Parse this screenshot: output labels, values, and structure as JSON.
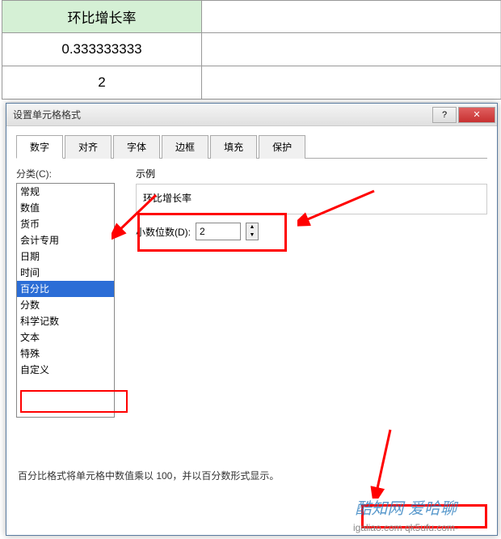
{
  "sheet": {
    "header": "环比增长率",
    "rows": [
      "0.333333333",
      "2"
    ]
  },
  "dialog": {
    "title": "设置单元格格式",
    "tabs": [
      "数字",
      "对齐",
      "字体",
      "边框",
      "填充",
      "保护"
    ],
    "category_label": "分类(C):",
    "categories": [
      "常规",
      "数值",
      "货币",
      "会计专用",
      "日期",
      "时间",
      "百分比",
      "分数",
      "科学记数",
      "文本",
      "特殊",
      "自定义"
    ],
    "selected_category": "百分比",
    "sample_label": "示例",
    "sample_value": "环比增长率",
    "decimal_label": "小数位数(D):",
    "decimal_value": "2",
    "description": "百分比格式将单元格中数值乘以 100，并以百分数形式显示。"
  },
  "watermark": {
    "text1": "酷知网 爱哈聊",
    "text2": "igaliao.com qk5ufu.com-"
  }
}
